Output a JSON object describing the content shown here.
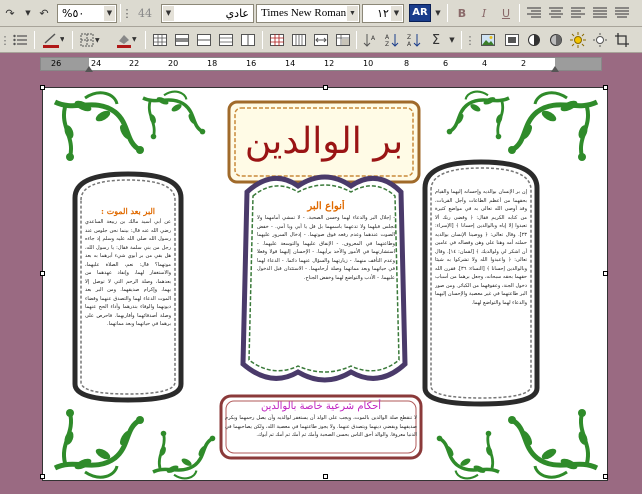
{
  "toolbar1": {
    "zoom": "%٥٠",
    "style": "عادي",
    "font": "Times New Roman",
    "size": "١٢",
    "language_button": "AR",
    "font_color_label": "A",
    "style_icon_label": "44"
  },
  "ruler": {
    "labels": [
      "26",
      "24",
      "22",
      "20",
      "18",
      "16",
      "14",
      "12",
      "10",
      "8",
      "6",
      "4",
      "2"
    ]
  },
  "document": {
    "title": "بر الوالدين",
    "left_panel": {
      "heading": "البر بعد الموت :",
      "body": "عن أبي أسيد مالك بن ربيعة الساعدي رضي الله عنه قال: بينما نحن جلوس عند رسول الله صلى الله عليه وسلم إذ جاءه رجل من بني سلمة فقال: يا رسول الله، هل بقي من بر أبوي شيء أبرهما به بعد موتهما؟ قال: نعم، الصلاة عليهما، والاستغفار لهما، وإنفاذ عهدهما من بعدهما، وصلة الرحم التي لا توصل إلا بهما، وإكرام صديقهما. ومن البر بعد الموت الدعاء لهما والتصدق عنهما وقضاء ديونهما والوفاء بنذرهما وأداء الحج عنهما وصلة أصدقائهما وأقاربهما. فاحرص على برهما في حياتهما وبعد مماتهما."
    },
    "middle_panel": {
      "heading": "أنواع البر",
      "body": "- إجلال البر والدعاء لهما وحسن الصحبة. - لا تمشي أمامهما ولا تجلس قبلهما ولا تدعهما باسمهما بل قل يا أبي ويا أمي. - خفض الصوت عندهما وعدم رفعه فوق صوتهما. - إدخال السرور عليهما وطاعتهما في المعروف. - الإنفاق عليهما والتوسعة عليهما. - استشارتهما في الأمور والأخذ برأيهما. - الإحسان إليهما قولا وفعلا وعدم التأفف منهما. - زيارتهما والسؤال عنهما دائما. - الدعاء لهما في حياتهما وبعد مماتهما وصلة أرحامهما. - الاستئذان قبل الدخول عليهما. - الأدب والتواضع لهما وخفض الجناح."
    },
    "right_panel": {
      "body": "إن بر الإنسان بوالديه وإحسانه إليهما والقيام بحقهما من أعظم الطاعات وأجل القربات، وقد أوصى الله تعالى به في مواضع كثيرة من كتابه الكريم فقال: ﴿ وقضى ربك ألا تعبدوا إلا إياه وبالوالدين إحسانا ﴾ [الإسراء: ٢٣]. وقال تعالى: ﴿ ووصينا الإنسان بوالديه حملته أمه وهنا على وهن وفصاله في عامين أن اشكر لي ولوالديك ﴾ [لقمان: ١٤]. وقال تعالى: ﴿ واعبدوا الله ولا تشركوا به شيئا وبالوالدين إحسانا ﴾ [النساء: ٣٦]. فقرن الله حقهما بحقه سبحانه، وجعل برهما من أسباب دخول الجنة، وعقوقهما من الكبائر. ومن صور البر طاعتهما في غير معصية والإحسان إليهما والدعاء لهما والتواضع لهما."
    },
    "bottom_panel": {
      "heading": "أحكام شرعية خاصة بالوالدين",
      "body": "لا تنقطع صلة الوالدين بالموت، ويجب على الولد أن يستغفر لوالديه وأن يصل رحمهما ويكرم صديقهما ويقضي دينهما ويتصدق عنهما. ولا يجوز طاعتهما في معصية الله، ولكن يصاحبهما في الدنيا معروفا. والوالد أحق الناس بحسن الصحبة وأمك ثم أمك ثم أمك ثم أبوك."
    }
  },
  "colors": {
    "toolbar_bg": "#dcdad0",
    "workspace_bg": "#9a6a82",
    "title_red": "#9a1414",
    "frame_dark": "#2b2b2b",
    "vine_green": "#2f8b2a",
    "orange_heading": "#e06a00",
    "magenta_heading": "#c020c0",
    "maroon_frame": "#8b3a3a",
    "ruler_gray": "#9c9c9c"
  }
}
